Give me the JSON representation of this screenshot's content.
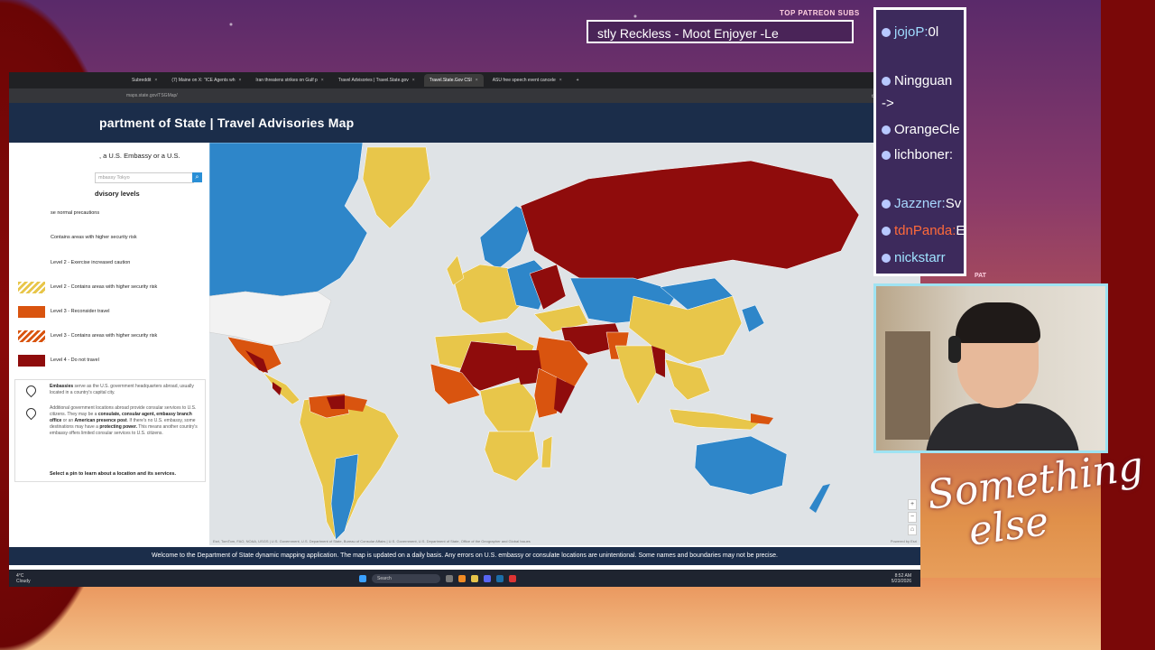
{
  "overlay": {
    "patreon_label": "TOP PATREON SUBS",
    "patreon_names": "stly Reckless - Moot Enjoyer -Le",
    "patron_tag": "PAT",
    "brand_line1": "Something",
    "brand_line2": "else"
  },
  "chat": [
    {
      "user": "jojoP:",
      "text": "0l",
      "color": "#9fdcff"
    },
    {
      "user": "Ningguan",
      "text": "",
      "color": "#ffffff"
    },
    {
      "user": "->",
      "text": "",
      "color": "#ffffff"
    },
    {
      "user": "OrangeCle",
      "text": "",
      "color": "#ffffff"
    },
    {
      "user": "lichboner:",
      "text": "",
      "color": "#ffffff"
    },
    {
      "user": "Jazzner:",
      "text": "Sv",
      "color": "#a8d8ff"
    },
    {
      "user": "tdnPanda:",
      "text": "E",
      "color": "#ff6a3a"
    },
    {
      "user": "nickstarr",
      "text": "",
      "color": "#9fe3ff"
    }
  ],
  "browser": {
    "tabs": [
      {
        "label": "Subreddit",
        "active": false
      },
      {
        "label": "(7) Maine on X: \"ICE Agents wh",
        "active": false
      },
      {
        "label": "Iran threatens strikes on Gulf p",
        "active": false
      },
      {
        "label": "Travel Advisories | Travel.State.gov",
        "active": false
      },
      {
        "label": "Travel.State.Gov CSI",
        "active": true
      },
      {
        "label": "ASU free speech event cancele",
        "active": false
      }
    ],
    "url": "maps.state.gov/TSGMap/"
  },
  "app": {
    "title": "partment of State | Travel Advisories Map",
    "find_label": ", a U.S. Embassy or a U.S.",
    "search_placeholder": "mbassy Tokyo",
    "levels_title": "dvisory levels",
    "legend": [
      {
        "label": "se normal precautions",
        "swatch": "lvl1"
      },
      {
        "label": "Contains areas with higher security risk",
        "swatch": "lvl1h"
      },
      {
        "label": "Level 2 - Exercise increased caution",
        "swatch": "lvl2"
      },
      {
        "label": "Level 2 - Contains areas with higher security risk",
        "swatch": "lvl2h"
      },
      {
        "label": "Level 3 - Reconsider travel",
        "swatch": "lvl3"
      },
      {
        "label": "Level 3 - Contains areas with higher security risk",
        "swatch": "lvl3h"
      },
      {
        "label": "Level 4 - Do not travel",
        "swatch": "lvl4"
      }
    ],
    "info": {
      "embassies_bold": "Embassies",
      "embassies_text": " serve as the U.S. government headquarters abroad, usually located in a country's capital city.",
      "other_text_1": "Additional government locations abroad provide consular services to U.S. citizens. They may be a ",
      "other_bold_1": "consulate, consular agent, embassy branch office",
      "other_text_2": " or an ",
      "other_bold_2": "American presence post",
      "other_text_3": ". If there's no U.S. embassy, some destinations may have a ",
      "other_bold_3": "protecting power.",
      "other_text_4": " This means another country's embassy offers limited consular services to U.S. citizens.",
      "select_hint": "Select a pin to learn about a location and its services."
    },
    "attribution": "Esri, TomTom, FAO, NOAA, USGS | U.S. Government, U.S. Department of State, Bureau of Consular Affairs | U.S. Government, U.S. Department of State, Office of the Geographer and Global Issues",
    "powered_by": "Powered by Esri",
    "footer": "Welcome to the Department of State dynamic mapping application. The map is updated on a daily basis.  Any errors on U.S. embassy or consulate locations are unintentional. Some names and boundaries may not be precise.",
    "colors": {
      "level1": "#2e86c9",
      "level2": "#e8c64a",
      "level3": "#d9540f",
      "level4": "#8f0c0c",
      "header": "#1b2d4a"
    }
  },
  "taskbar": {
    "weather_temp": "4°C",
    "weather_desc": "Cloudy",
    "search": "Search",
    "time": "8:52 AM",
    "date": "5/23/2026"
  }
}
